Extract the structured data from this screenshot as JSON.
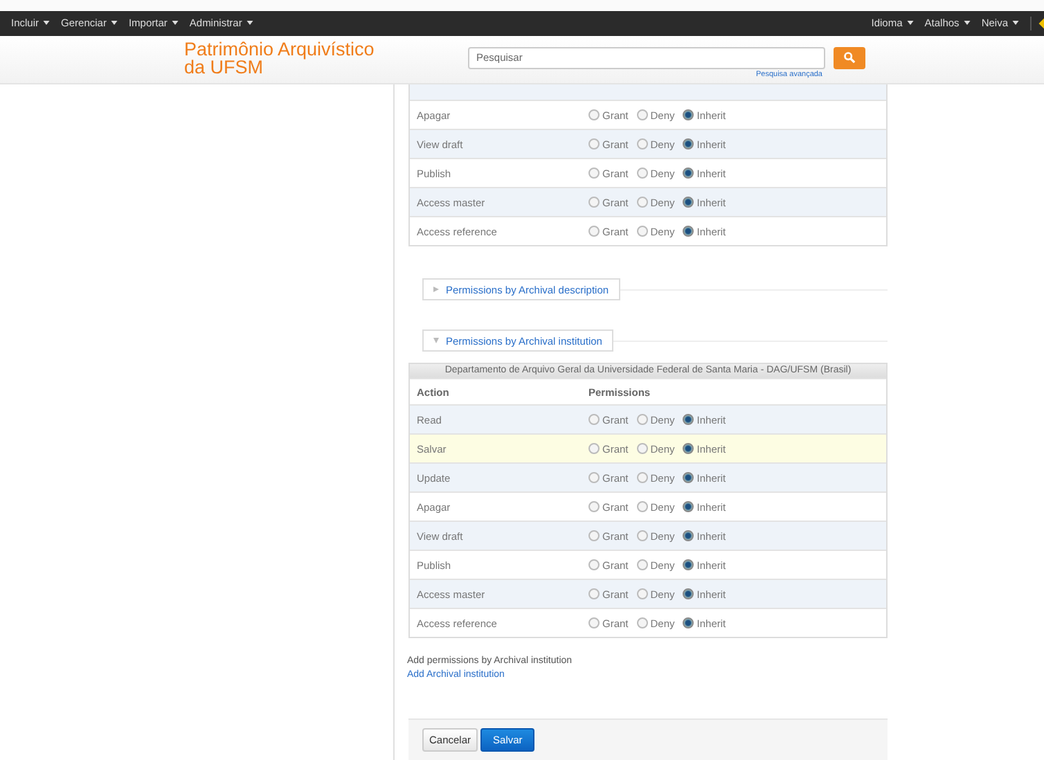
{
  "navbar": {
    "left": [
      {
        "label": "Incluir"
      },
      {
        "label": "Gerenciar"
      },
      {
        "label": "Importar"
      },
      {
        "label": "Administrar"
      }
    ],
    "right": [
      {
        "label": "Idioma"
      },
      {
        "label": "Atalhos"
      },
      {
        "label": "Neiva"
      }
    ]
  },
  "header": {
    "logo_lines": [
      "Patrimônio Arquivístico",
      "da UFSM"
    ],
    "search": {
      "placeholder": "Pesquisar"
    },
    "advanced_link": "Pesquisa avançada"
  },
  "table_top": {
    "rows": [
      {
        "action": "Apagar",
        "highlighted": false,
        "options": [
          {
            "label": "Grant",
            "selected": false
          },
          {
            "label": "Deny",
            "selected": false
          },
          {
            "label": "Inherit",
            "selected": true
          }
        ]
      },
      {
        "action": "View draft",
        "highlighted": false,
        "options": [
          {
            "label": "Grant",
            "selected": false
          },
          {
            "label": "Deny",
            "selected": false
          },
          {
            "label": "Inherit",
            "selected": true
          }
        ]
      },
      {
        "action": "Publish",
        "highlighted": false,
        "options": [
          {
            "label": "Grant",
            "selected": false
          },
          {
            "label": "Deny",
            "selected": false
          },
          {
            "label": "Inherit",
            "selected": true
          }
        ]
      },
      {
        "action": "Access master",
        "highlighted": false,
        "options": [
          {
            "label": "Grant",
            "selected": false
          },
          {
            "label": "Deny",
            "selected": false
          },
          {
            "label": "Inherit",
            "selected": true
          }
        ]
      },
      {
        "action": "Access reference",
        "highlighted": false,
        "options": [
          {
            "label": "Grant",
            "selected": false
          },
          {
            "label": "Deny",
            "selected": false
          },
          {
            "label": "Inherit",
            "selected": true
          }
        ]
      }
    ]
  },
  "sections": [
    {
      "legend": "Permissions by Archival description",
      "expanded": false
    },
    {
      "legend": "Permissions by Archival institution",
      "expanded": true
    }
  ],
  "table_institution": {
    "caption": "Departamento de Arquivo Geral da Universidade Federal de Santa Maria - DAG/UFSM (Brasil)",
    "columns": [
      "Action",
      "Permissions"
    ],
    "rows": [
      {
        "action": "Read",
        "highlighted": false,
        "options": [
          {
            "label": "Grant",
            "selected": false
          },
          {
            "label": "Deny",
            "selected": false
          },
          {
            "label": "Inherit",
            "selected": true
          }
        ]
      },
      {
        "action": "Salvar",
        "highlighted": true,
        "options": [
          {
            "label": "Grant",
            "selected": false
          },
          {
            "label": "Deny",
            "selected": false
          },
          {
            "label": "Inherit",
            "selected": true
          }
        ]
      },
      {
        "action": "Update",
        "highlighted": false,
        "options": [
          {
            "label": "Grant",
            "selected": false
          },
          {
            "label": "Deny",
            "selected": false
          },
          {
            "label": "Inherit",
            "selected": true
          }
        ]
      },
      {
        "action": "Apagar",
        "highlighted": false,
        "options": [
          {
            "label": "Grant",
            "selected": false
          },
          {
            "label": "Deny",
            "selected": false
          },
          {
            "label": "Inherit",
            "selected": true
          }
        ]
      },
      {
        "action": "View draft",
        "highlighted": false,
        "options": [
          {
            "label": "Grant",
            "selected": false
          },
          {
            "label": "Deny",
            "selected": false
          },
          {
            "label": "Inherit",
            "selected": true
          }
        ]
      },
      {
        "action": "Publish",
        "highlighted": false,
        "options": [
          {
            "label": "Grant",
            "selected": false
          },
          {
            "label": "Deny",
            "selected": false
          },
          {
            "label": "Inherit",
            "selected": true
          }
        ]
      },
      {
        "action": "Access master",
        "highlighted": false,
        "options": [
          {
            "label": "Grant",
            "selected": false
          },
          {
            "label": "Deny",
            "selected": false
          },
          {
            "label": "Inherit",
            "selected": true
          }
        ]
      },
      {
        "action": "Access reference",
        "highlighted": false,
        "options": [
          {
            "label": "Grant",
            "selected": false
          },
          {
            "label": "Deny",
            "selected": false
          },
          {
            "label": "Inherit",
            "selected": true
          }
        ]
      }
    ]
  },
  "add_label": "Add permissions by Archival institution",
  "add_link": "Add Archival institution",
  "buttons": [
    {
      "label": "Cancelar",
      "kind": "secondary"
    },
    {
      "label": "Salvar",
      "kind": "primary"
    }
  ]
}
